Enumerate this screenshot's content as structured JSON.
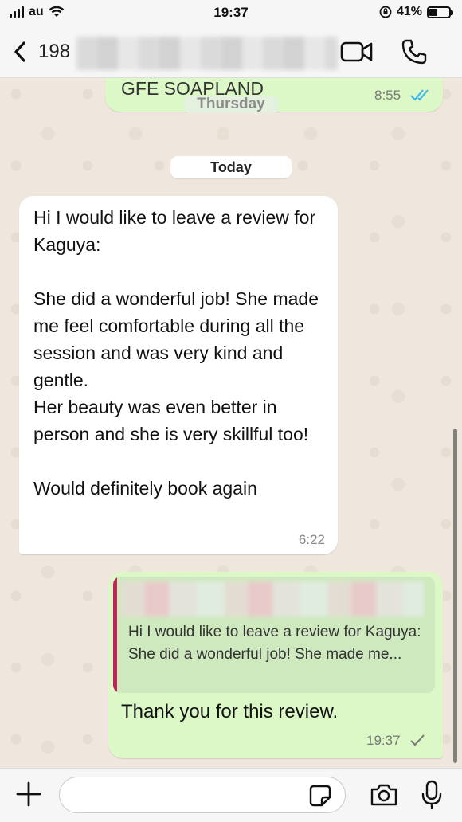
{
  "status_bar": {
    "carrier": "au",
    "time": "19:37",
    "battery": "41%",
    "battery_level": 0.41
  },
  "header": {
    "contact_prefix": "198"
  },
  "top_message": {
    "text": "GFE SOAPLAND",
    "time": "8:55",
    "day_label": "Thursday"
  },
  "date_separator": "Today",
  "incoming_message": {
    "text": "Hi I would like to leave a review for Kaguya:\n\nShe did a wonderful job! She made me feel comfortable during all the session and was very kind and gentle.\nHer beauty was even better in person and she is very skillful too!\n\nWould definitely book again",
    "time": "6:22"
  },
  "outgoing_message": {
    "quote_line1": "Hi I would like to leave a review for Kaguya:",
    "quote_line2": "She did a wonderful job! She made me...",
    "text": "Thank you for this review.",
    "time": "19:37"
  },
  "composer": {
    "placeholder": ""
  },
  "colors": {
    "outgoing_bubble": "#dcf8c6",
    "incoming_bubble": "#ffffff",
    "read_check": "#34b7f1",
    "quote_accent": "#c0245a",
    "chat_background": "#efe7dd"
  },
  "icons": [
    "back-chevron-icon",
    "video-call-icon",
    "phone-icon",
    "double-check-icon",
    "single-check-icon",
    "plus-icon",
    "sticker-icon",
    "camera-icon",
    "microphone-icon"
  ]
}
